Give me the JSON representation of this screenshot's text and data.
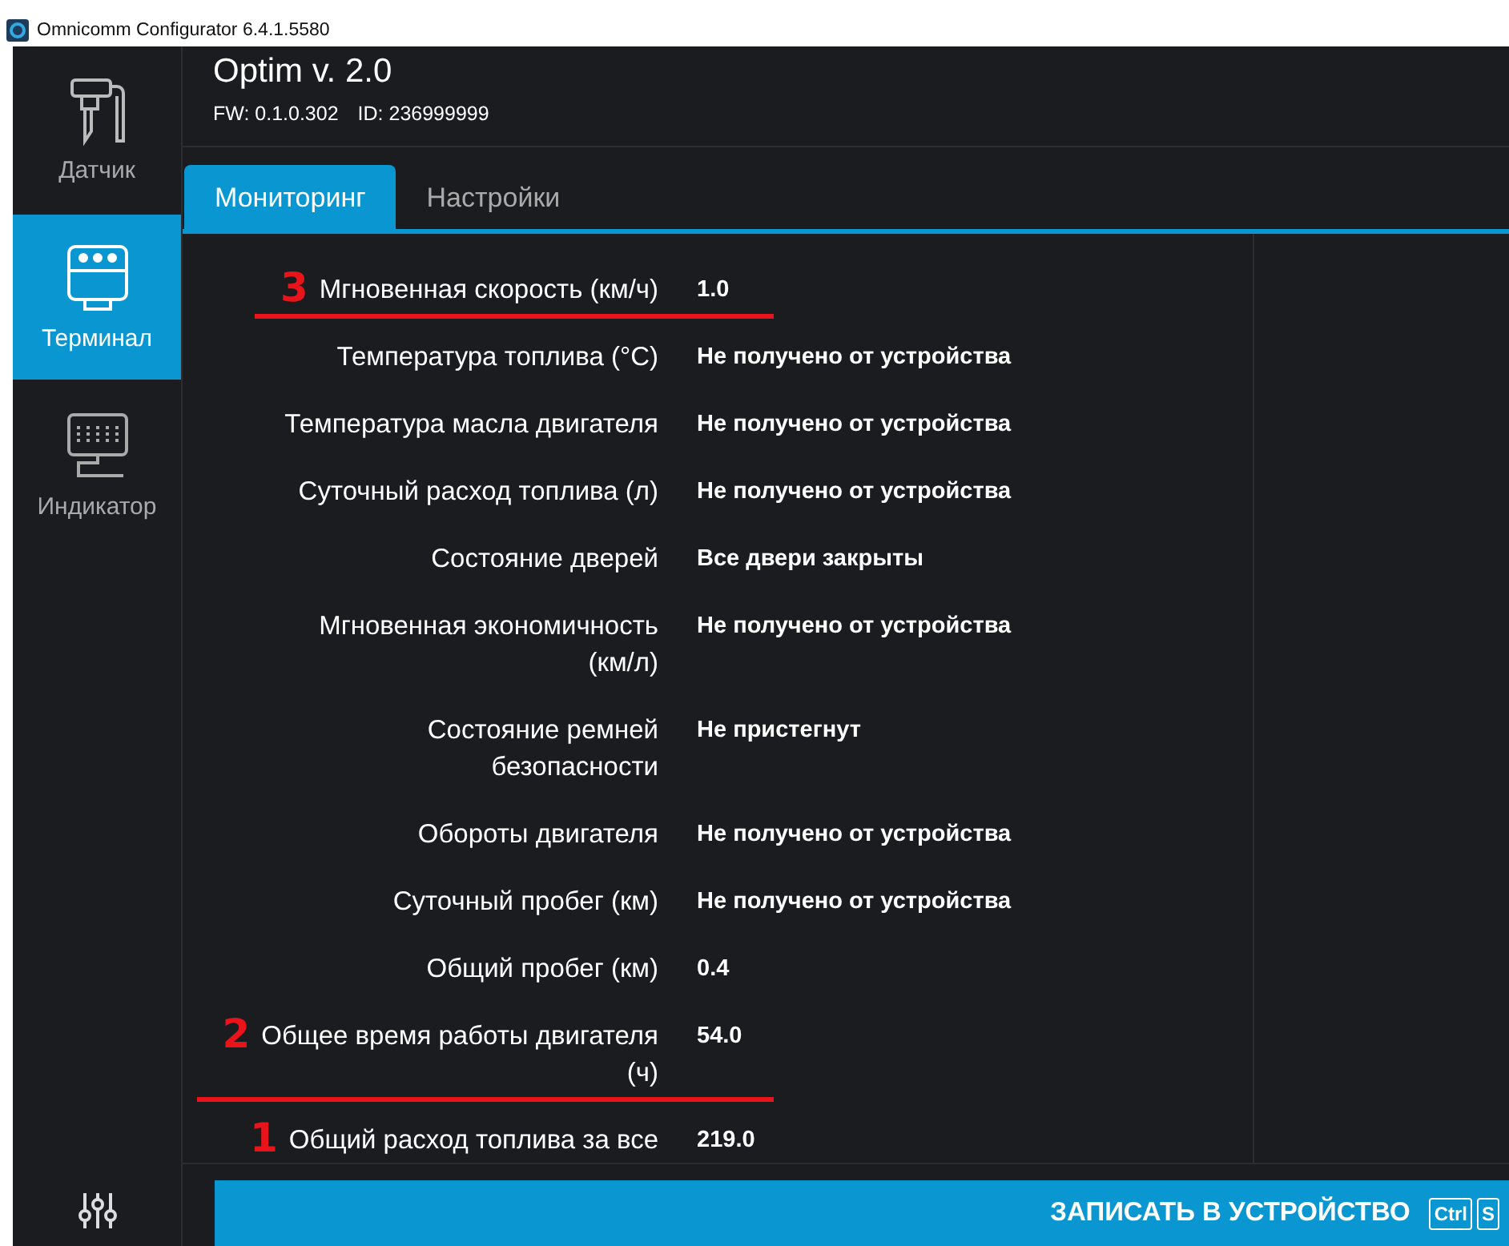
{
  "window": {
    "title": "Omnicomm Configurator 6.4.1.5580"
  },
  "sidebar": {
    "items": [
      {
        "label": "Датчик",
        "kind": "probe",
        "selected": false
      },
      {
        "label": "Терминал",
        "kind": "terminal",
        "selected": true
      },
      {
        "label": "Индикатор",
        "kind": "display",
        "selected": false
      }
    ]
  },
  "header": {
    "device": "Optim v. 2.0",
    "firmware": "FW: 0.1.0.302",
    "id": "ID: 236999999"
  },
  "tabs": [
    {
      "label": "Мониторинг",
      "selected": true
    },
    {
      "label": "Настройки",
      "selected": false
    }
  ],
  "rows": [
    {
      "label": "Мгновенная скорость (км/ч)",
      "value": "1.0",
      "marker": "3"
    },
    {
      "label": "Температура топлива (°C)",
      "value": "Не получено от устройства"
    },
    {
      "label": "Температура масла двигателя",
      "value": "Не получено от устройства"
    },
    {
      "label": "Суточный расход топлива (л)",
      "value": "Не получено от устройства"
    },
    {
      "label": "Состояние дверей",
      "value": "Все двери закрыты"
    },
    {
      "label": "Мгновенная экономичность\n(км/л)",
      "value": "Не получено от устройства"
    },
    {
      "label": "Состояние ремней\nбезопасности",
      "value": "Не пристегнут"
    },
    {
      "label": "Обороты двигателя",
      "value": "Не получено от устройства"
    },
    {
      "label": "Суточный пробег (км)",
      "value": "Не получено от устройства"
    },
    {
      "label": "Общий пробег (км)",
      "value": "0.4"
    },
    {
      "label": "Общее время работы двигателя\n(ч)",
      "value": "54.0",
      "marker": "2"
    },
    {
      "label": "Общий расход топлива за все",
      "value": "219.0",
      "marker": "1"
    }
  ],
  "write_button": {
    "label": "ЗАПИСАТЬ В УСТРОЙСТВО",
    "keys": [
      "Ctrl",
      "S"
    ]
  }
}
